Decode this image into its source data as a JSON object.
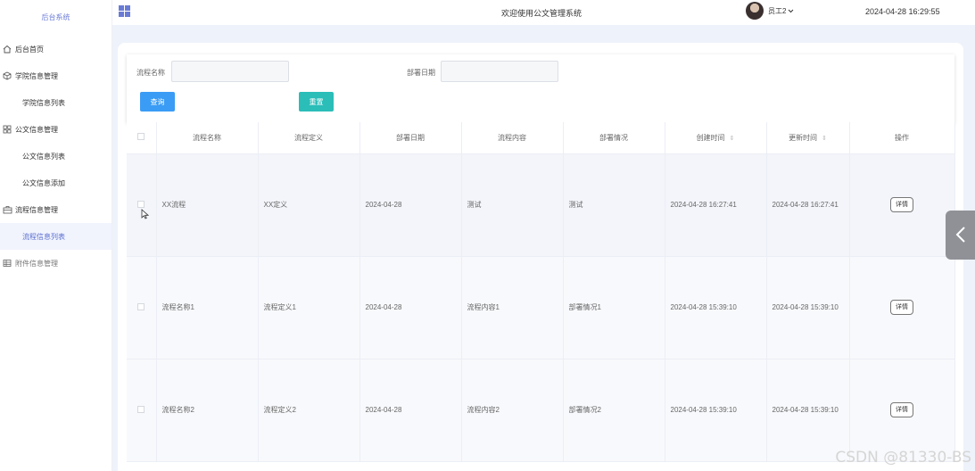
{
  "brand": "后台系统",
  "menu": [
    {
      "label": "后台首页",
      "icon": "home-icon",
      "type": "top"
    },
    {
      "label": "学院信息管理",
      "icon": "cube-icon",
      "type": "top"
    },
    {
      "label": "学院信息列表",
      "type": "sub"
    },
    {
      "label": "公文信息管理",
      "icon": "grid-icon",
      "type": "top"
    },
    {
      "label": "公文信息列表",
      "type": "sub"
    },
    {
      "label": "公文信息添加",
      "type": "sub"
    },
    {
      "label": "流程信息管理",
      "icon": "briefcase-icon",
      "type": "top"
    },
    {
      "label": "流程信息列表",
      "type": "sub",
      "active": true
    },
    {
      "label": "附件信息管理",
      "icon": "table-icon",
      "type": "top",
      "muted": true
    }
  ],
  "header": {
    "welcome": "欢迎使用公文管理系统",
    "user": "员工2",
    "datetime": "2024-04-28 16:29:55"
  },
  "search": {
    "name_label": "流程名称",
    "date_label": "部署日期",
    "query_label": "查询",
    "reset_label": "重置"
  },
  "table": {
    "columns": [
      "流程名称",
      "流程定义",
      "部署日期",
      "流程内容",
      "部署情况",
      "创建时间",
      "更新时间",
      "操作"
    ],
    "rows": [
      {
        "name": "XX流程",
        "definition": "XX定义",
        "date": "2024-04-28",
        "content": "测试",
        "status": "测试",
        "created": "2024-04-28 16:27:41",
        "updated": "2024-04-28 16:27:41",
        "action": "详情"
      },
      {
        "name": "流程名称1",
        "definition": "流程定义1",
        "date": "2024-04-28",
        "content": "流程内容1",
        "status": "部署情况1",
        "created": "2024-04-28 15:39:10",
        "updated": "2024-04-28 15:39:10",
        "action": "详情"
      },
      {
        "name": "流程名称2",
        "definition": "流程定义2",
        "date": "2024-04-28",
        "content": "流程内容2",
        "status": "部署情况2",
        "created": "2024-04-28 15:39:10",
        "updated": "2024-04-28 15:39:10",
        "action": "详情"
      }
    ]
  },
  "watermark": "CSDN @81330-BS",
  "colors": {
    "accent": "#6a7bd6",
    "query": "#3a9cf5",
    "reset": "#2bbdb8"
  }
}
